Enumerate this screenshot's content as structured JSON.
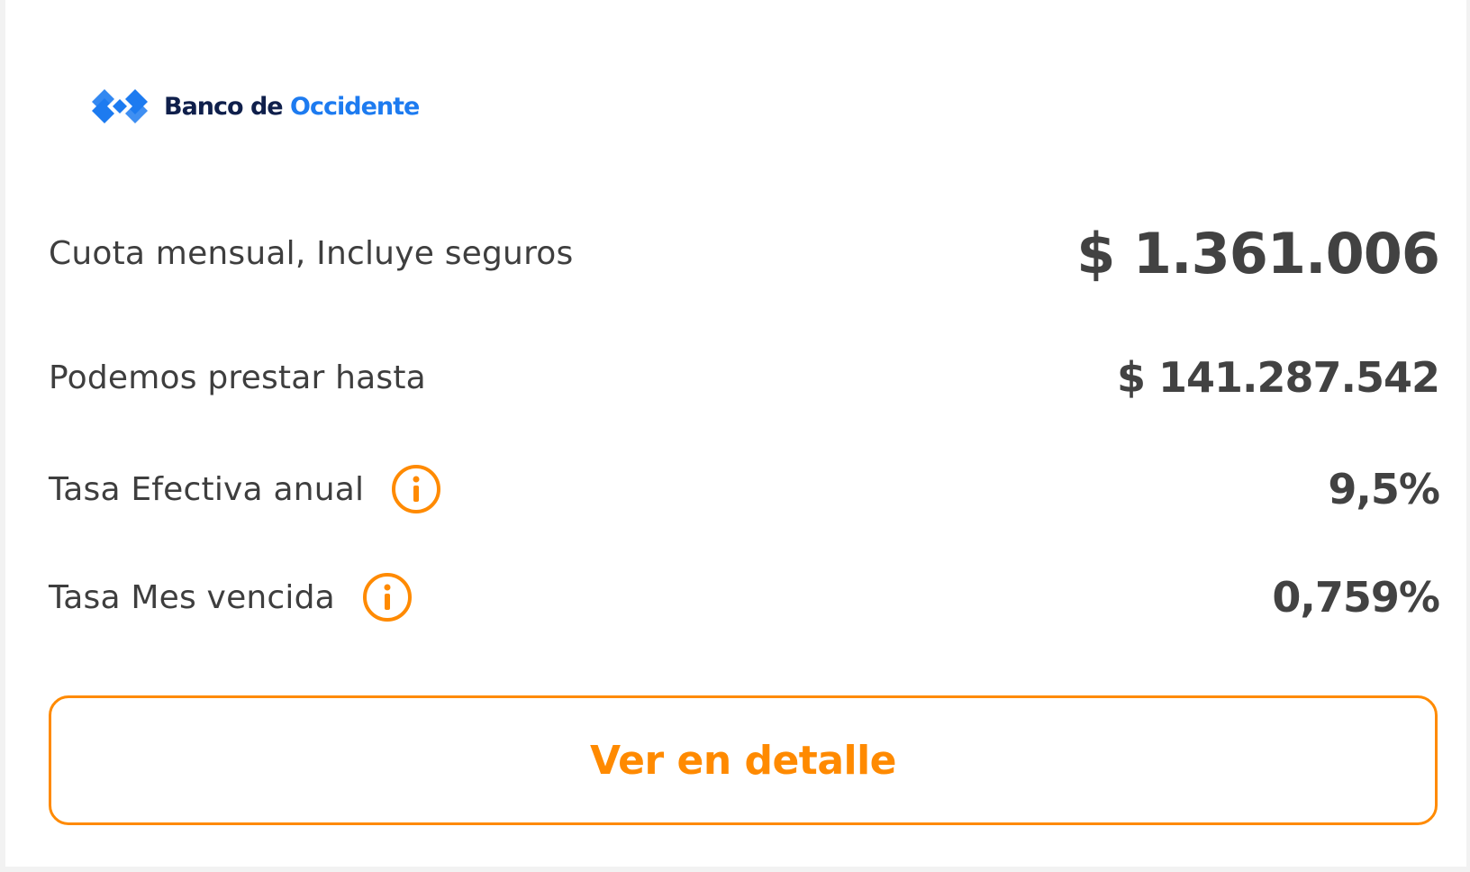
{
  "brand": {
    "name_part1": "Banco de",
    "name_part2": "Occidente",
    "logo_icon": "banco-de-occidente-logo-icon",
    "colors": {
      "dark_blue": "#0f1f4b",
      "blue": "#1d7bf0"
    }
  },
  "rows": [
    {
      "label": "Cuota mensual, Incluye seguros",
      "value": "$ 1.361.006"
    },
    {
      "label": "Podemos prestar hasta",
      "value": "$ 141.287.542"
    },
    {
      "label": "Tasa Efectiva anual",
      "value": "9,5%",
      "icon": "info-icon"
    },
    {
      "label": "Tasa Mes vencida",
      "value": "0,759%",
      "icon": "info-icon"
    }
  ],
  "button": {
    "label": "Ver en detalle"
  },
  "colors": {
    "accent": "#ff8a00",
    "text": "#3e3e3e"
  }
}
